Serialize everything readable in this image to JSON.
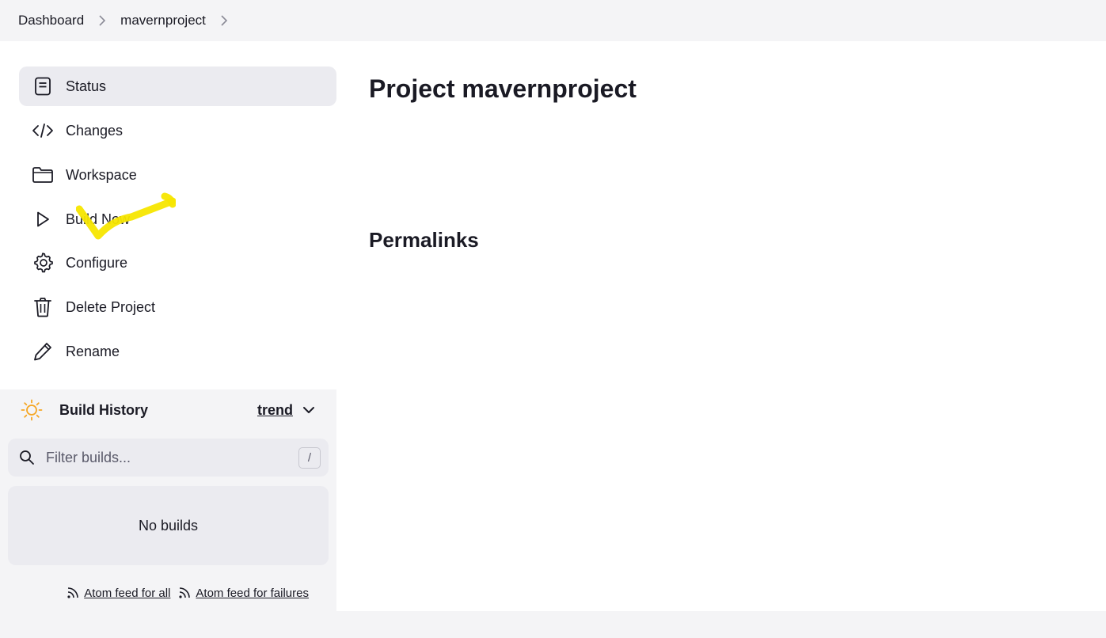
{
  "breadcrumb": {
    "items": [
      "Dashboard",
      "mavernproject"
    ]
  },
  "tasks": [
    {
      "label": "Status",
      "icon": "status-icon",
      "active": true
    },
    {
      "label": "Changes",
      "icon": "code-icon"
    },
    {
      "label": "Workspace",
      "icon": "folder-icon"
    },
    {
      "label": "Build Now",
      "icon": "play-icon"
    },
    {
      "label": "Configure",
      "icon": "gear-icon"
    },
    {
      "label": "Delete Project",
      "icon": "trash-icon"
    },
    {
      "label": "Rename",
      "icon": "pencil-icon"
    }
  ],
  "build_history": {
    "title": "Build History",
    "trend_label": "trend",
    "filter_placeholder": "Filter builds...",
    "shortcut_key": "/",
    "empty_text": "No builds",
    "feed_all": "Atom feed for all",
    "feed_failures": "Atom feed for failures"
  },
  "main": {
    "title": "Project mavernproject",
    "permalinks_heading": "Permalinks"
  },
  "colors": {
    "page_bg": "#f4f4f6",
    "panel_bg": "#ffffff",
    "active_task_bg": "#ebebf0",
    "sun_accent": "#f5a623",
    "highlight_mark": "#f7e600"
  }
}
